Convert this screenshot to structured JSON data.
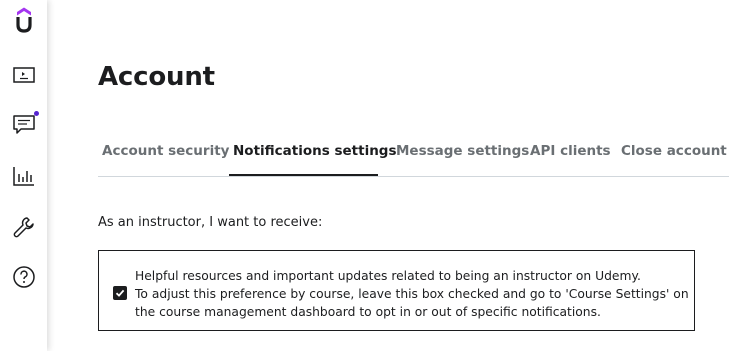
{
  "sidebar": {
    "logo_icon": "udemy-logo-icon",
    "items": [
      {
        "icon": "courses-icon"
      },
      {
        "icon": "communication-icon",
        "has_notification": true
      },
      {
        "icon": "performance-icon"
      },
      {
        "icon": "tools-icon"
      },
      {
        "icon": "help-icon"
      }
    ]
  },
  "page": {
    "title": "Account"
  },
  "tabs": [
    {
      "label": "Account security",
      "active": false
    },
    {
      "label": "Notifications settings",
      "active": true
    },
    {
      "label": "Message settings",
      "active": false
    },
    {
      "label": "API clients",
      "active": false
    },
    {
      "label": "Close account",
      "active": false
    }
  ],
  "notifications": {
    "intro": "As an instructor, I want to receive:",
    "option": {
      "checked": true,
      "lines": [
        "Helpful resources and important updates related to being an instructor on Udemy.",
        "To adjust this preference by course, leave this box checked and go to 'Course Settings' on",
        "the course management dashboard to opt in or out of specific notifications."
      ]
    }
  },
  "colors": {
    "brand_purple": "#a435f0",
    "notification_dot": "#5624d0",
    "text": "#1c1d1f",
    "muted_tab": "#6a6f73",
    "divider": "#d1d7dc"
  }
}
